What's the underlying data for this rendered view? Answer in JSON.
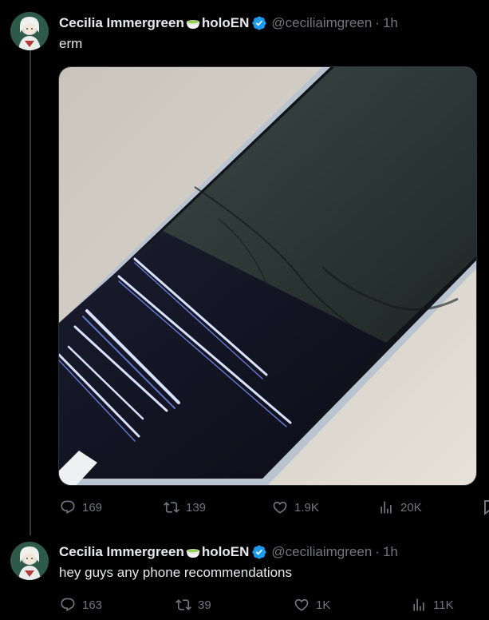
{
  "colors": {
    "background": "#000000",
    "text": "#e7e9ea",
    "muted": "#71767b",
    "verified": "#1d9bf0",
    "thread_line": "#333639"
  },
  "tweets": [
    {
      "display_name_prefix": "Cecilia Immergreen",
      "name_emoji": "matcha-tea-emoji",
      "display_name_suffix": "holoEN",
      "verified_icon": "verified-badge-icon",
      "handle": "@ceciliaimgreen",
      "separator": "·",
      "time": "1h",
      "text": "erm",
      "media": "photo-of-cracked-phone-screen",
      "actions": {
        "replies": "169",
        "reposts": "139",
        "likes": "1.9K",
        "views": "20K"
      }
    },
    {
      "display_name_prefix": "Cecilia Immergreen",
      "name_emoji": "matcha-tea-emoji",
      "display_name_suffix": "holoEN",
      "verified_icon": "verified-badge-icon",
      "handle": "@ceciliaimgreen",
      "separator": "·",
      "time": "1h",
      "text": "hey guys any phone recommendations",
      "actions": {
        "replies": "163",
        "reposts": "39",
        "likes": "1K",
        "views": "11K"
      }
    }
  ]
}
